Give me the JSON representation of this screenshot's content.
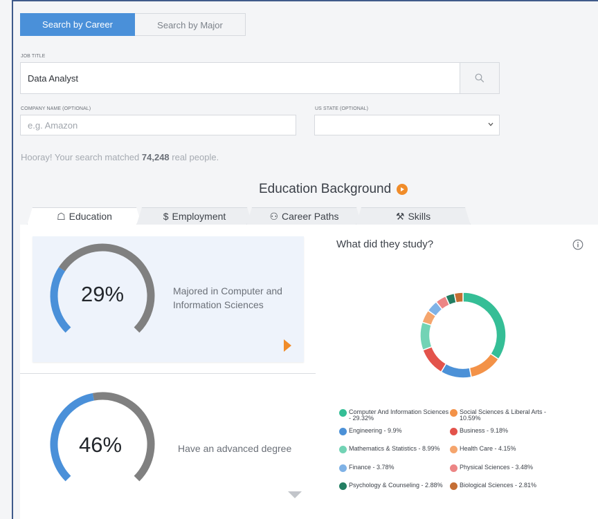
{
  "top_tabs": {
    "career": "Search by Career",
    "major": "Search by Major"
  },
  "form": {
    "job_title_label": "JOB TITLE",
    "job_title_value": "Data Analyst",
    "company_label": "COMPANY NAME (OPTIONAL)",
    "company_placeholder": "e.g. Amazon",
    "state_label": "US STATE (OPTIONAL)",
    "state_value": ""
  },
  "match": {
    "prefix": "Hooray! Your search matched ",
    "count": "74,248",
    "suffix": " real people."
  },
  "section_title": "Education Background",
  "tabs": [
    {
      "icon": "☖",
      "label": "Education"
    },
    {
      "icon": "$",
      "label": "Employment"
    },
    {
      "icon": "⚇",
      "label": "Career Paths"
    },
    {
      "icon": "⚒",
      "label": "Skills"
    }
  ],
  "gauges": [
    {
      "pct_text": "29%",
      "fraction": 0.29,
      "label": "Majored in Computer and Information Sciences"
    },
    {
      "pct_text": "46%",
      "fraction": 0.46,
      "label": "Have an advanced degree"
    }
  ],
  "study": {
    "title": "What did they study?"
  },
  "chart_data": {
    "type": "pie",
    "title": "What did they study?",
    "categories": [
      "Computer And Information Sciences",
      "Social Sciences & Liberal Arts",
      "Engineering",
      "Business",
      "Mathematics & Statistics",
      "Health Care",
      "Finance",
      "Physical Sciences",
      "Psychology & Counseling",
      "Biological Sciences"
    ],
    "values": [
      29.32,
      10.59,
      9.9,
      9.18,
      8.99,
      4.15,
      3.78,
      3.48,
      2.88,
      2.81
    ],
    "legend": [
      {
        "text": "Computer And Information Sciences - 29.32%",
        "color": "#35be96"
      },
      {
        "text": "Social Sciences & Liberal Arts - 10.59%",
        "color": "#f39248"
      },
      {
        "text": "Engineering - 9.9%",
        "color": "#4c91d7"
      },
      {
        "text": "Business - 9.18%",
        "color": "#e3534b"
      },
      {
        "text": "Mathematics & Statistics - 8.99%",
        "color": "#72d3b5"
      },
      {
        "text": "Health Care - 4.15%",
        "color": "#f5a56d"
      },
      {
        "text": "Finance - 3.78%",
        "color": "#7fb2e6"
      },
      {
        "text": "Physical Sciences - 3.48%",
        "color": "#ec8585"
      },
      {
        "text": "Psychology & Counseling - 2.88%",
        "color": "#237e62"
      },
      {
        "text": "Biological Sciences - 2.81%",
        "color": "#c56e34"
      }
    ],
    "chart_order": [
      "Computer And Information Sciences",
      "Social Sciences & Liberal Arts",
      "Engineering",
      "Business",
      "Mathematics & Statistics",
      "Health Care",
      "Finance",
      "Physical Sciences",
      "Psychology & Counseling",
      "Biological Sciences"
    ]
  },
  "colors": {
    "accent_blue": "#4a90d9",
    "gauge_grey": "#808080",
    "orange": "#f08c2a"
  }
}
